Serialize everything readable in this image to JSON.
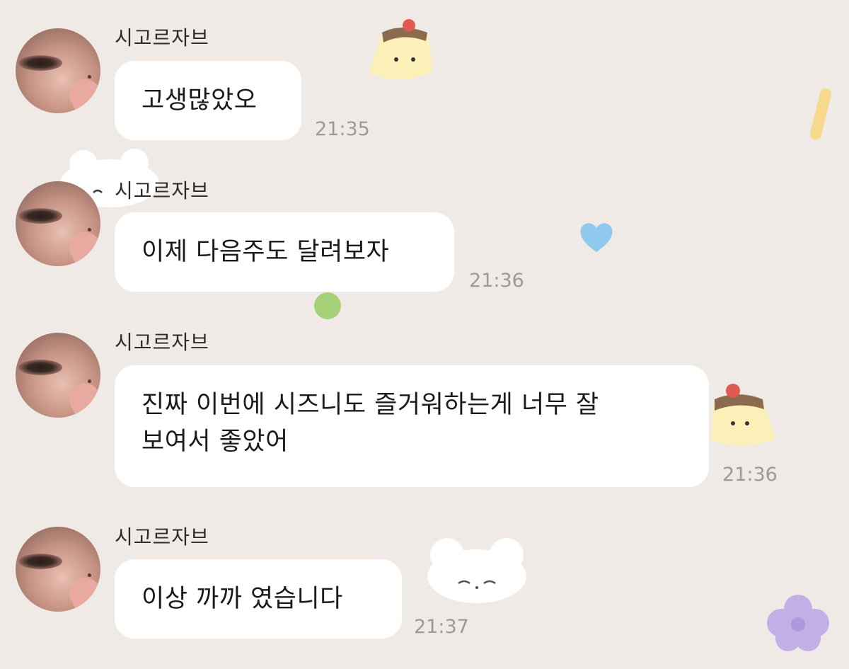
{
  "colors": {
    "background": "#efeae5",
    "bubble": "#ffffff",
    "time": "#9c9a97",
    "sender": "#2b2b2b"
  },
  "messages": [
    {
      "sender": "시고르자브",
      "text": "고생많았오",
      "time": "21:35"
    },
    {
      "sender": "시고르자브",
      "text": "이제 다음주도 달려보자",
      "time": "21:36"
    },
    {
      "sender": "시고르자브",
      "text": "진짜 이번에 시즈니도 즐거워하는게 너무 잘\n보여서 좋았어",
      "time": "21:36"
    },
    {
      "sender": "시고르자브",
      "text": "이상 까까 였습니다",
      "time": "21:37"
    }
  ],
  "decorations": [
    "pudding-sticker",
    "bear-sticker",
    "heart-sticker",
    "flower-sticker",
    "dot-sticker",
    "stick-sticker"
  ]
}
